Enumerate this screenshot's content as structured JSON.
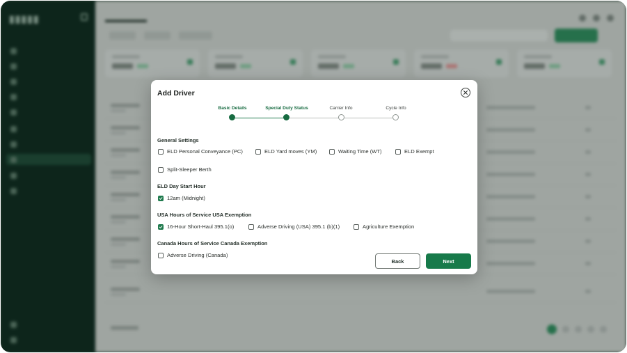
{
  "modal": {
    "title": "Add Driver",
    "steps": [
      {
        "label": "Basic Details",
        "state": "done"
      },
      {
        "label": "Special Duty Status",
        "state": "done"
      },
      {
        "label": "Carrier Info",
        "state": "todo"
      },
      {
        "label": "Cycle Info",
        "state": "todo"
      }
    ],
    "sections": {
      "general": {
        "title": "General Settings",
        "options": [
          {
            "label": "ELD Personal Conveyance (PC)",
            "checked": false
          },
          {
            "label": "ELD Yard moves (YM)",
            "checked": false
          },
          {
            "label": "Waiting Time (WT)",
            "checked": false
          },
          {
            "label": "ELD Exempt",
            "checked": false
          },
          {
            "label": "Split-Sleeper Berth",
            "checked": false
          }
        ]
      },
      "eld_day": {
        "title": "ELD Day Start Hour",
        "options": [
          {
            "label": "12am (Midnight)",
            "checked": true
          }
        ]
      },
      "usa": {
        "title": "USA Hours of Service USA Exemption",
        "options": [
          {
            "label": "16-Hour Short-Haul 395.1(o)",
            "checked": true
          },
          {
            "label": "Adverse Driving (USA) 395.1 (b)(1)",
            "checked": false
          },
          {
            "label": "Agriculture Exemption",
            "checked": false
          }
        ]
      },
      "canada": {
        "title": "Canada Hours of Service Canada Exemption",
        "options": [
          {
            "label": "Adverse Driving (Canada)",
            "checked": false
          }
        ]
      }
    },
    "buttons": {
      "back": "Back",
      "next": "Next"
    }
  },
  "colors": {
    "accent": "#177a4a",
    "sidebar": "#0f2a1e"
  },
  "icons": {
    "close": "close-icon",
    "check": "check-icon"
  }
}
